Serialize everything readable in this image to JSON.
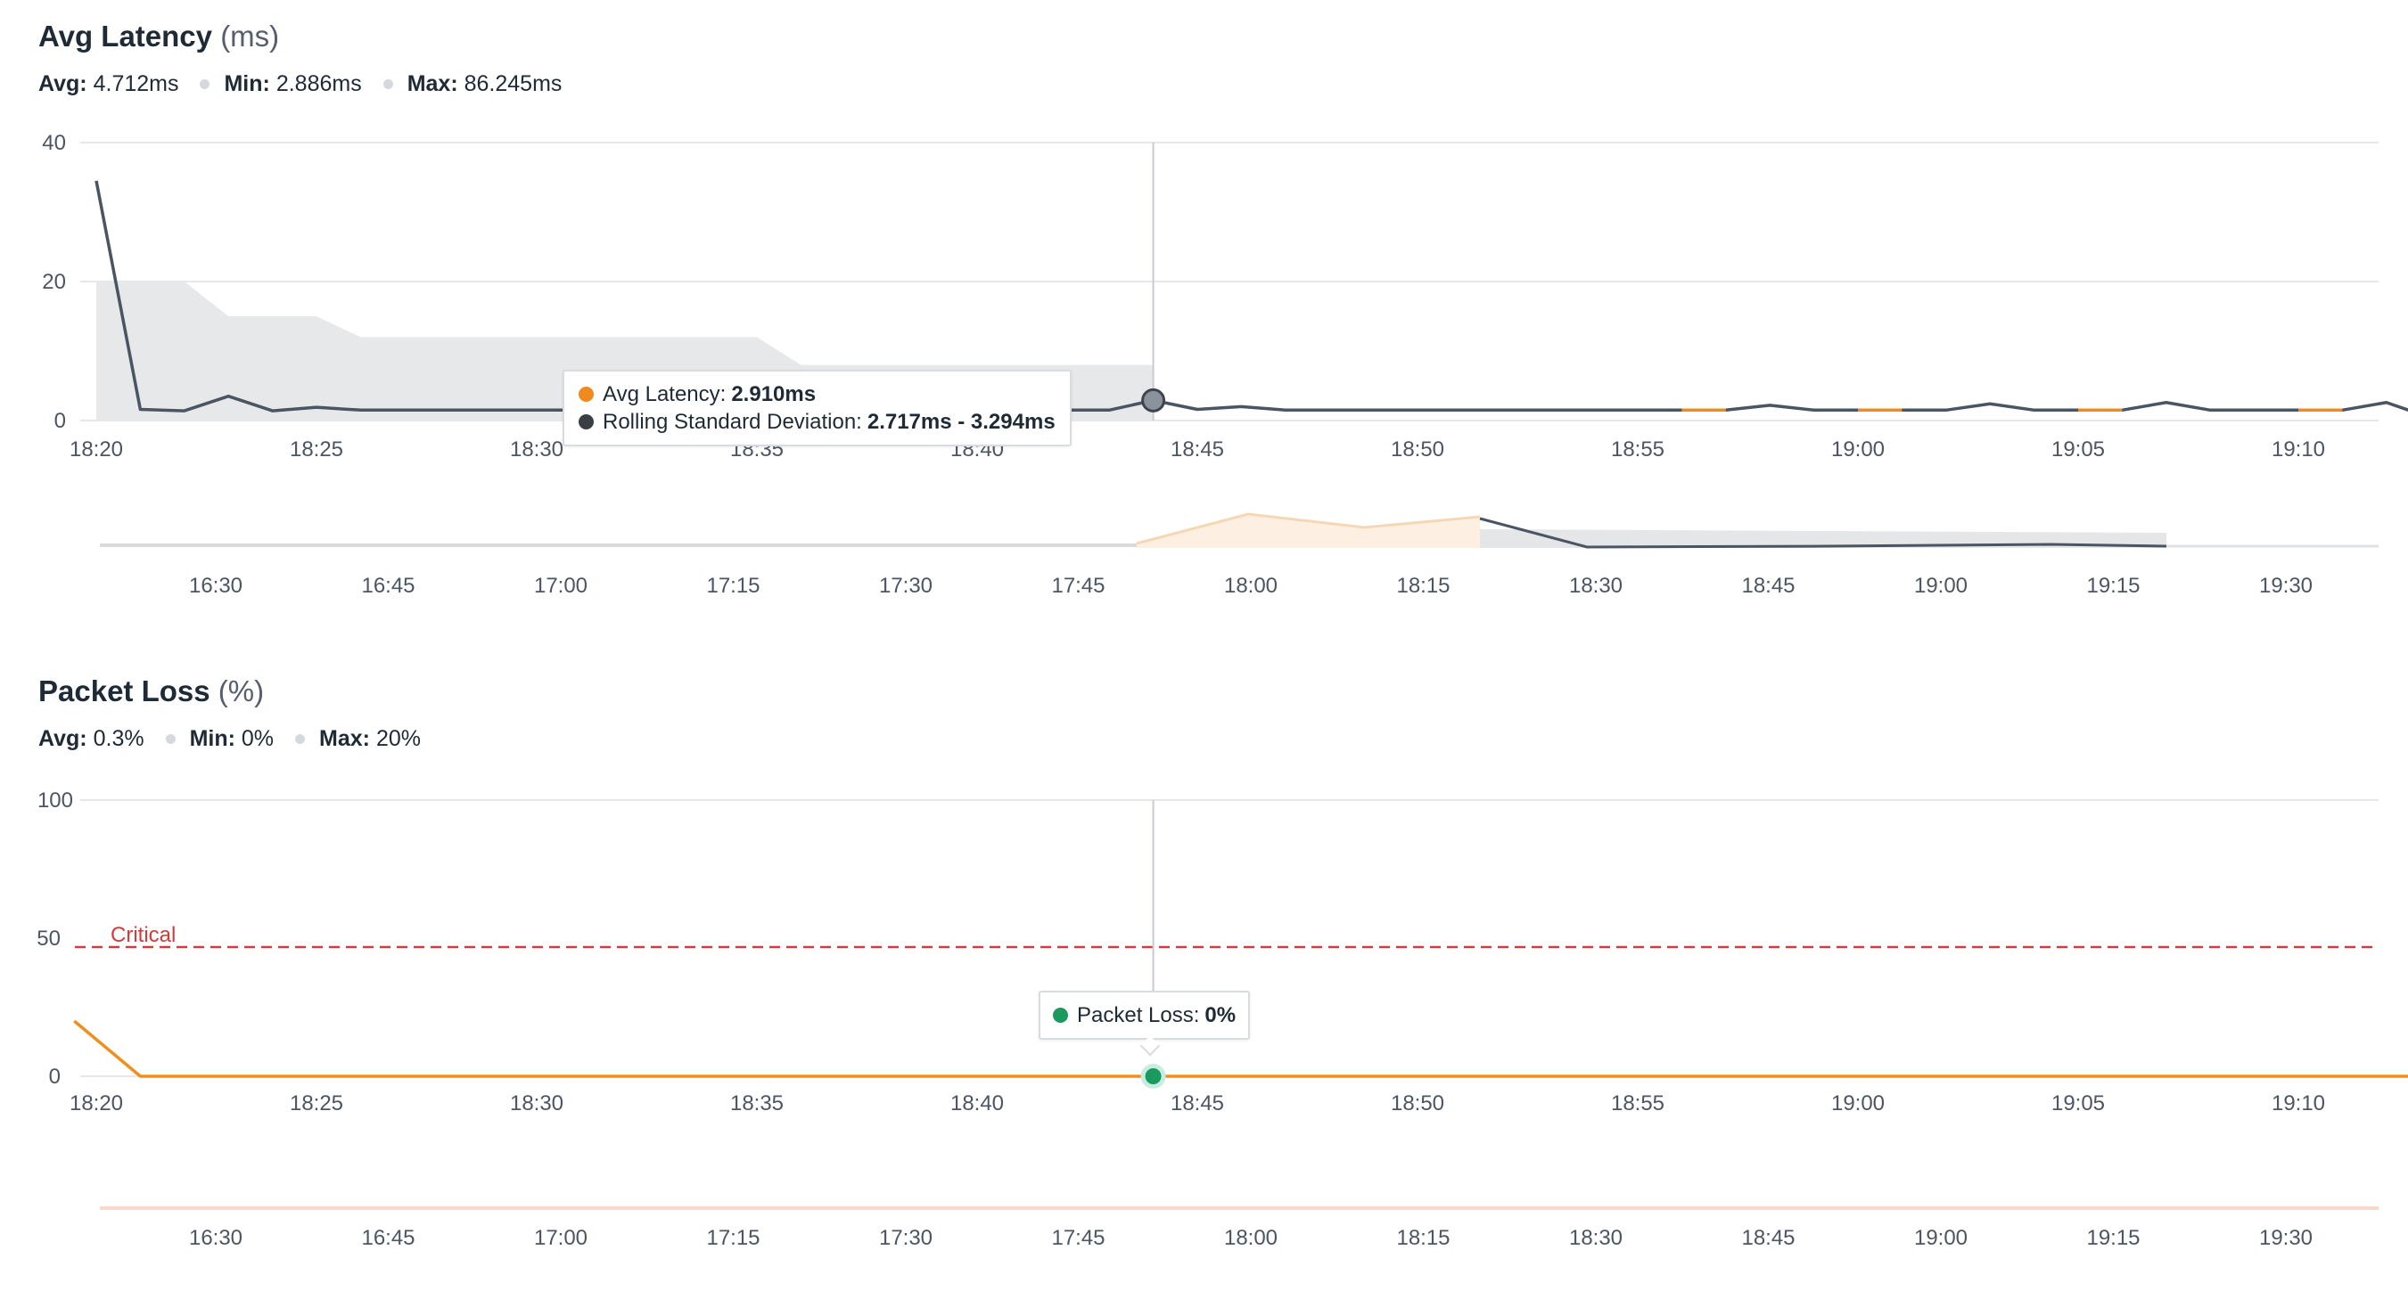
{
  "latency": {
    "title": "Avg Latency",
    "unit": "(ms)",
    "stats": {
      "avg_label": "Avg:",
      "avg_value": "4.712ms",
      "min_label": "Min:",
      "min_value": "2.886ms",
      "max_label": "Max:",
      "max_value": "86.245ms"
    },
    "tooltip": {
      "line1_label": "Avg Latency:",
      "line1_value": "2.910ms",
      "line2_label": "Rolling Standard Deviation:",
      "line2_value": "2.717ms - 3.294ms"
    }
  },
  "packet_loss": {
    "title": "Packet Loss",
    "unit": "(%)",
    "stats": {
      "avg_label": "Avg:",
      "avg_value": "0.3%",
      "min_label": "Min:",
      "min_value": "0%",
      "max_label": "Max:",
      "max_value": "20%"
    },
    "tooltip": {
      "label": "Packet Loss:",
      "value": "0%"
    }
  },
  "colors": {
    "latency_line": "#4a5563",
    "latency_spike": "#f08a1f",
    "band": "#e7e8ea",
    "grid": "#e6e7e9",
    "critical": "#d33a3a",
    "loss_line": "#ef8f1c",
    "loss_point": "#1b9a5f",
    "axis_text": "#4b5563"
  },
  "chart_data": [
    {
      "type": "line",
      "title": "Avg Latency (ms)",
      "ylim": [
        0,
        40
      ],
      "yticks": [
        "0",
        "20",
        "40"
      ],
      "xticks": [
        "18:20",
        "18:25",
        "18:30",
        "18:35",
        "18:40",
        "18:45",
        "18:50",
        "18:55",
        "19:00",
        "19:05",
        "19:10"
      ],
      "xrange_minutes": [
        0,
        52.5
      ],
      "series": [
        {
          "name": "Avg Latency",
          "x": [
            0,
            1,
            2,
            3,
            4,
            5,
            6,
            7,
            8,
            9,
            10,
            11,
            12,
            13,
            14,
            15,
            16,
            17,
            18,
            19,
            20,
            21,
            22,
            23,
            24,
            25,
            26,
            27,
            28,
            29,
            30,
            31,
            32,
            33,
            34,
            35,
            36,
            37,
            38,
            39,
            40,
            41,
            42,
            43,
            44,
            45,
            46,
            47,
            48,
            49,
            50,
            51,
            52,
            52.5
          ],
          "y": [
            34.5,
            1.6,
            1.4,
            3.5,
            1.4,
            1.9,
            1.5,
            1.5,
            1.5,
            1.5,
            1.5,
            1.5,
            1.5,
            1.5,
            1.5,
            1.5,
            1.5,
            1.5,
            1.5,
            1.5,
            1.5,
            1.5,
            1.5,
            1.5,
            2.9,
            1.6,
            2.0,
            1.5,
            1.5,
            1.5,
            1.5,
            1.5,
            1.5,
            1.5,
            1.5,
            1.5,
            1.5,
            1.5,
            2.2,
            1.5,
            1.5,
            1.5,
            1.5,
            2.4,
            1.5,
            1.5,
            1.5,
            2.6,
            1.5,
            1.5,
            1.5,
            1.5,
            2.6,
            1.5
          ],
          "spikes": [
            [
              36.0,
              37.0
            ],
            [
              40.0,
              41.0
            ],
            [
              45.0,
              46.0
            ],
            [
              50.0,
              51.0
            ]
          ]
        },
        {
          "name": "Rolling Standard Deviation",
          "band_x": [
            0,
            2,
            3,
            5,
            6,
            15,
            16,
            24
          ],
          "band_hi": [
            20,
            20,
            15,
            15,
            12,
            12,
            8,
            8
          ],
          "note": "band ends at 18:44"
        }
      ],
      "hover": {
        "x": 24,
        "y": 2.9
      },
      "navigator_ticks": [
        "16:30",
        "16:45",
        "17:00",
        "17:15",
        "17:30",
        "17:45",
        "18:00",
        "18:15",
        "18:30",
        "18:45",
        "19:00",
        "19:15",
        "19:30"
      ]
    },
    {
      "type": "line",
      "title": "Packet Loss (%)",
      "ylim": [
        0,
        100
      ],
      "yticks": [
        "0",
        "50",
        "100"
      ],
      "threshold": {
        "label": "Critical",
        "value": 50
      },
      "xticks": [
        "18:20",
        "18:25",
        "18:30",
        "18:35",
        "18:40",
        "18:45",
        "18:50",
        "18:55",
        "19:00",
        "19:05",
        "19:10"
      ],
      "series": [
        {
          "name": "Packet Loss",
          "x": [
            -0.5,
            1,
            52.5
          ],
          "y": [
            20,
            0,
            0
          ]
        }
      ],
      "hover": {
        "x": 24,
        "y": 0
      },
      "navigator_ticks": [
        "16:30",
        "16:45",
        "17:00",
        "17:15",
        "17:30",
        "17:45",
        "18:00",
        "18:15",
        "18:30",
        "18:45",
        "19:00",
        "19:15",
        "19:30"
      ]
    }
  ]
}
